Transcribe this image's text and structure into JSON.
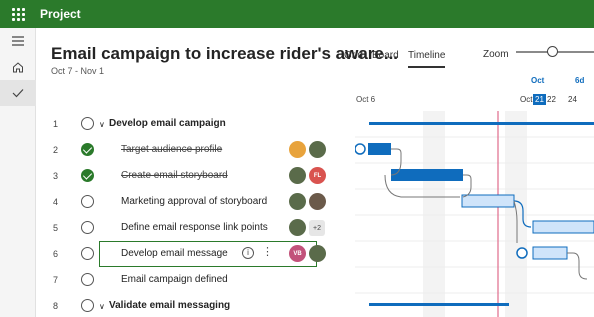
{
  "app": {
    "title": "Project"
  },
  "plan": {
    "title": "Email campaign to increase rider's aware...",
    "dates": "Oct 7 - Nov 1"
  },
  "views": [
    {
      "label": "Grid",
      "active": false
    },
    {
      "label": "Board",
      "active": false
    },
    {
      "label": "Timeline",
      "active": true
    }
  ],
  "zoom": {
    "label": "Zoom",
    "level": 0.4
  },
  "timeline_header": {
    "month_label": "Oct 6",
    "top_labels": [
      "Oct",
      "6d"
    ],
    "day_prefix": "Oct",
    "days": [
      "21",
      "22",
      "24"
    ]
  },
  "tasks": [
    {
      "num": "1",
      "name": "Develop email campaign",
      "summary": true,
      "done": false,
      "strike": false,
      "assignees": []
    },
    {
      "num": "2",
      "name": "Target audience profile",
      "summary": false,
      "done": true,
      "strike": true,
      "assignees": [
        {
          "initials": "",
          "color": "#e8a33c"
        },
        {
          "initials": "",
          "color": "#5a6b4a"
        }
      ]
    },
    {
      "num": "3",
      "name": "Create email storyboard",
      "summary": false,
      "done": true,
      "strike": true,
      "assignees": [
        {
          "initials": "",
          "color": "#5a6b4a"
        },
        {
          "initials": "FL",
          "color": "#d9534f"
        }
      ]
    },
    {
      "num": "4",
      "name": "Marketing approval of storyboard",
      "summary": false,
      "done": false,
      "strike": false,
      "assignees": [
        {
          "initials": "",
          "color": "#5a6b4a"
        },
        {
          "initials": "",
          "color": "#6b5a4a"
        }
      ]
    },
    {
      "num": "5",
      "name": "Define email response link points",
      "summary": false,
      "done": false,
      "strike": false,
      "assignees": [
        {
          "initials": "",
          "color": "#5a6b4a"
        }
      ],
      "extra": "+2"
    },
    {
      "num": "6",
      "name": "Develop email message",
      "summary": false,
      "done": false,
      "strike": false,
      "selected": true,
      "assignees": [
        {
          "initials": "VB",
          "color": "#c2527a"
        },
        {
          "initials": "",
          "color": "#5a6b4a"
        }
      ]
    },
    {
      "num": "7",
      "name": "Email campaign defined",
      "summary": false,
      "done": false,
      "strike": false,
      "assignees": []
    },
    {
      "num": "8",
      "name": "Validate email messaging",
      "summary": true,
      "done": false,
      "strike": false,
      "assignees": []
    }
  ],
  "colors": {
    "brand": "#2b7a2b",
    "accent": "#0f6cbd",
    "today_line": "#e06b8b"
  }
}
